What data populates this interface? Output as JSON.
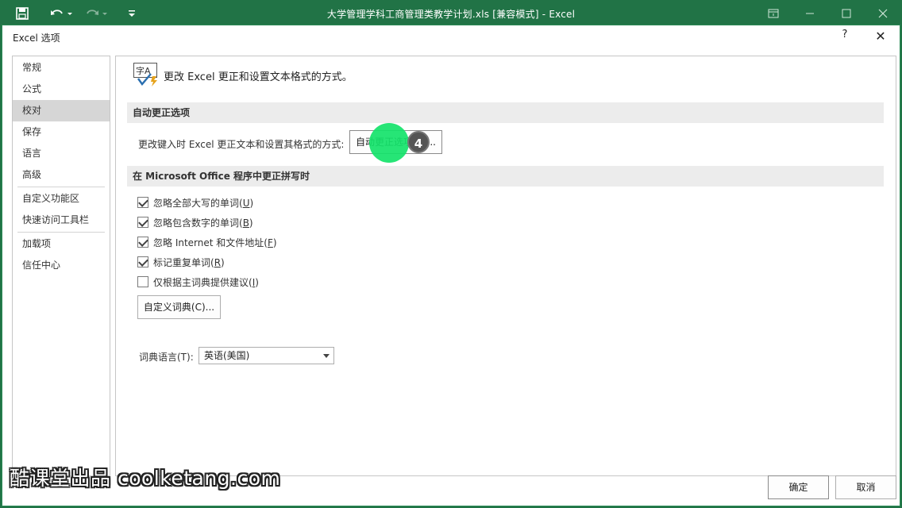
{
  "titlebar": {
    "title": "大学管理学科工商管理类教学计划.xls  [兼容模式] - Excel"
  },
  "dialog": {
    "title": "Excel 选项",
    "help": "?",
    "close": "✕"
  },
  "nav": {
    "items": [
      "常规",
      "公式",
      "校对",
      "保存",
      "语言",
      "高级",
      "自定义功能区",
      "快速访问工具栏",
      "加载项",
      "信任中心"
    ],
    "selected_index": 2
  },
  "content": {
    "header": "更改 Excel 更正和设置文本格式的方式。",
    "icon_text": "字A",
    "autocorrect_section": "自动更正选项",
    "autocorrect_label": "更改键入时 Excel 更正文本和设置其格式的方式:",
    "autocorrect_button": "自动更正选项(A)...",
    "spelling_section": "在 Microsoft Office 程序中更正拼写时",
    "checks": [
      {
        "pre": "忽略全部大写的单词(",
        "key": "U",
        "post": ")",
        "checked": true
      },
      {
        "pre": "忽略包含数字的单词(",
        "key": "B",
        "post": ")",
        "checked": true
      },
      {
        "pre": "忽略 Internet 和文件地址(",
        "key": "F",
        "post": ")",
        "checked": true
      },
      {
        "pre": "标记重复单词(",
        "key": "R",
        "post": ")",
        "checked": true
      },
      {
        "pre": "仅根据主词典提供建议(",
        "key": "I",
        "post": ")",
        "checked": false
      }
    ],
    "custom_dict_button": "自定义词典(C)...",
    "dict_lang_label": "词典语言(T):",
    "dict_lang_value": "英语(美国)"
  },
  "step_badge": "4",
  "watermark": "酷课堂出品 coolketang.com",
  "footer": {
    "ok": "确定",
    "cancel": "取消"
  }
}
